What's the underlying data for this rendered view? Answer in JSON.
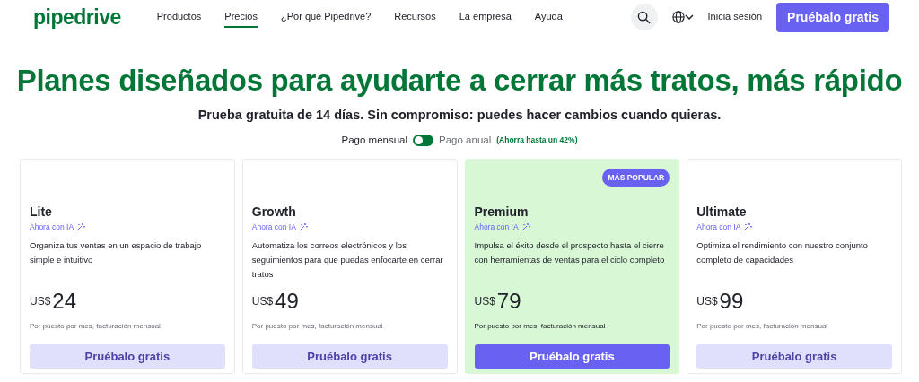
{
  "header": {
    "logo": "pipedrive",
    "nav": [
      {
        "label": "Productos",
        "selected": false
      },
      {
        "label": "Precios",
        "selected": true
      },
      {
        "label": "¿Por qué Pipedrive?",
        "selected": false
      },
      {
        "label": "Recursos",
        "selected": false
      },
      {
        "label": "La empresa",
        "selected": false
      },
      {
        "label": "Ayuda",
        "selected": false
      }
    ],
    "login": "Inicia sesión",
    "cta": "Pruébalo gratis"
  },
  "hero": {
    "title": "Planes diseñados para ayudarte a cerrar más tratos, más rápido",
    "subtitle": "Prueba gratuita de 14 días. Sin compromiso: puedes hacer cambios cuando quieras."
  },
  "billing": {
    "monthly_label": "Pago mensual",
    "annual_label": "Pago anual",
    "savings": "(Ahorra hasta un 42%)",
    "annual": false
  },
  "plans": [
    {
      "name": "Lite",
      "ai_label": "Ahora con IA",
      "description": "Organiza tus ventas en un espacio de trabajo simple e intuitivo",
      "currency": "US$",
      "price": "24",
      "note": "Por puesto por mes, facturación mensual",
      "button": "Pruébalo gratis",
      "featured": false
    },
    {
      "name": "Growth",
      "ai_label": "Ahora con IA",
      "description": "Automatiza los correos electrónicos y los seguimientos para que puedas enfocarte en cerrar tratos",
      "currency": "US$",
      "price": "49",
      "note": "Por puesto por mes, facturación mensual",
      "button": "Pruébalo gratis",
      "featured": false
    },
    {
      "name": "Premium",
      "badge": "MÁS POPULAR",
      "ai_label": "Ahora con IA",
      "description": "Impulsa el éxito desde el prospecto hasta el cierre con herramientas de ventas para el ciclo completo",
      "currency": "US$",
      "price": "79",
      "note": "Por puesto por mes, facturación mensual",
      "button": "Pruébalo gratis",
      "featured": true
    },
    {
      "name": "Ultimate",
      "ai_label": "Ahora con IA",
      "description": "Optimiza el rendimiento con nuestro conjunto completo de capacidades",
      "currency": "US$",
      "price": "99",
      "note": "Por puesto por mes, facturación mensual",
      "button": "Pruébalo gratis",
      "featured": false
    }
  ]
}
